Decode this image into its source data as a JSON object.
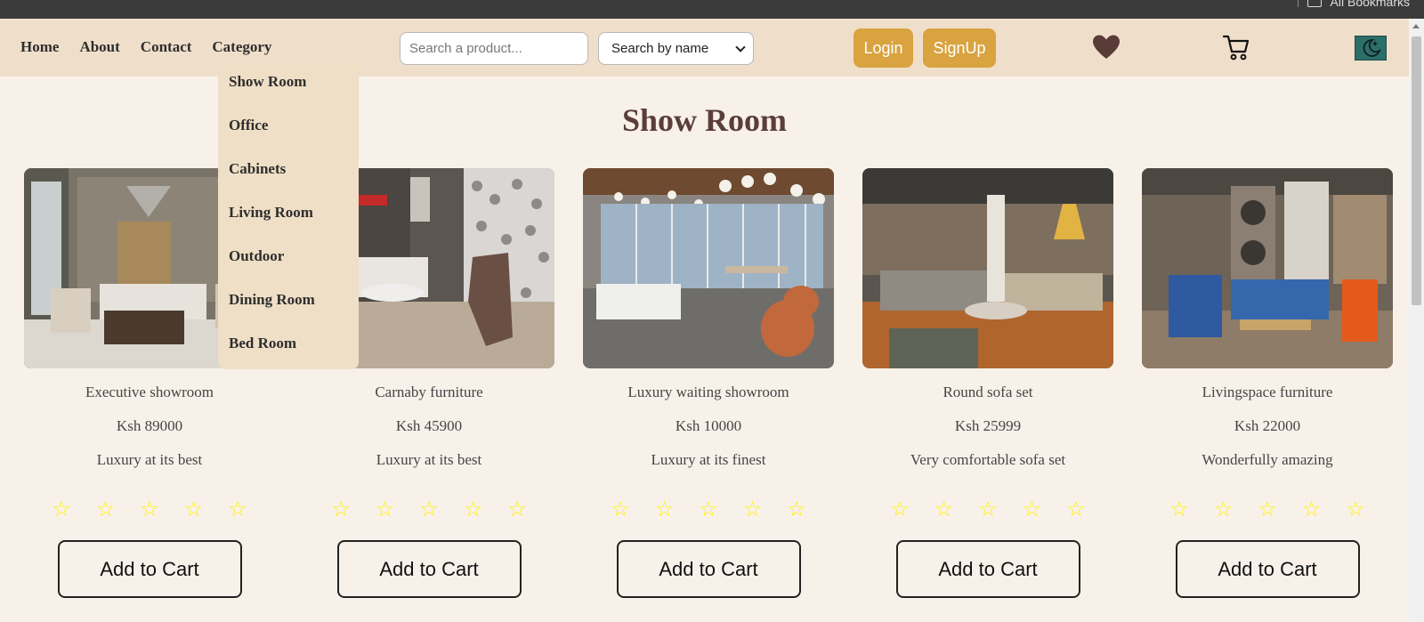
{
  "browser": {
    "bookmarks_label": "All Bookmarks"
  },
  "nav": {
    "links": [
      "Home",
      "About",
      "Contact",
      "Category"
    ]
  },
  "search": {
    "placeholder": "Search a product...",
    "select_value": "Search by name"
  },
  "auth": {
    "login_label": "Login",
    "signup_label": "SignUp"
  },
  "icons": {
    "wishlist": "heart-icon",
    "cart": "cart-icon",
    "theme": "moon-icon"
  },
  "colors": {
    "navbar": "#efdfca",
    "background": "#f8f1ea",
    "accent": "#d9a33f",
    "title": "#5a3e3a",
    "star": "#fff200",
    "theme_button": "#2c6e6a"
  },
  "dropdown": {
    "items": [
      "Show Room",
      "Office",
      "Cabinets",
      "Living Room",
      "Outdoor",
      "Dining Room",
      "Bed Room"
    ]
  },
  "section": {
    "title": "Show Room"
  },
  "products": [
    {
      "name": "Executive showroom",
      "price": "Ksh 89000",
      "description": "Luxury at its best",
      "stars": [
        "☆",
        "☆",
        "☆",
        "☆",
        "☆"
      ],
      "button": "Add to Cart"
    },
    {
      "name": "Carnaby furniture",
      "price": "Ksh 45900",
      "description": "Luxury at its best",
      "stars": [
        "☆",
        "☆",
        "☆",
        "☆",
        "☆"
      ],
      "button": "Add to Cart"
    },
    {
      "name": "Luxury waiting showroom",
      "price": "Ksh 10000",
      "description": "Luxury at its finest",
      "stars": [
        "☆",
        "☆",
        "☆",
        "☆",
        "☆"
      ],
      "button": "Add to Cart"
    },
    {
      "name": "Round sofa set",
      "price": "Ksh 25999",
      "description": "Very comfortable sofa set",
      "stars": [
        "☆",
        "☆",
        "☆",
        "☆",
        "☆"
      ],
      "button": "Add to Cart"
    },
    {
      "name": "Livingspace furniture",
      "price": "Ksh 22000",
      "description": "Wonderfully amazing",
      "stars": [
        "☆",
        "☆",
        "☆",
        "☆",
        "☆"
      ],
      "button": "Add to Cart"
    }
  ]
}
